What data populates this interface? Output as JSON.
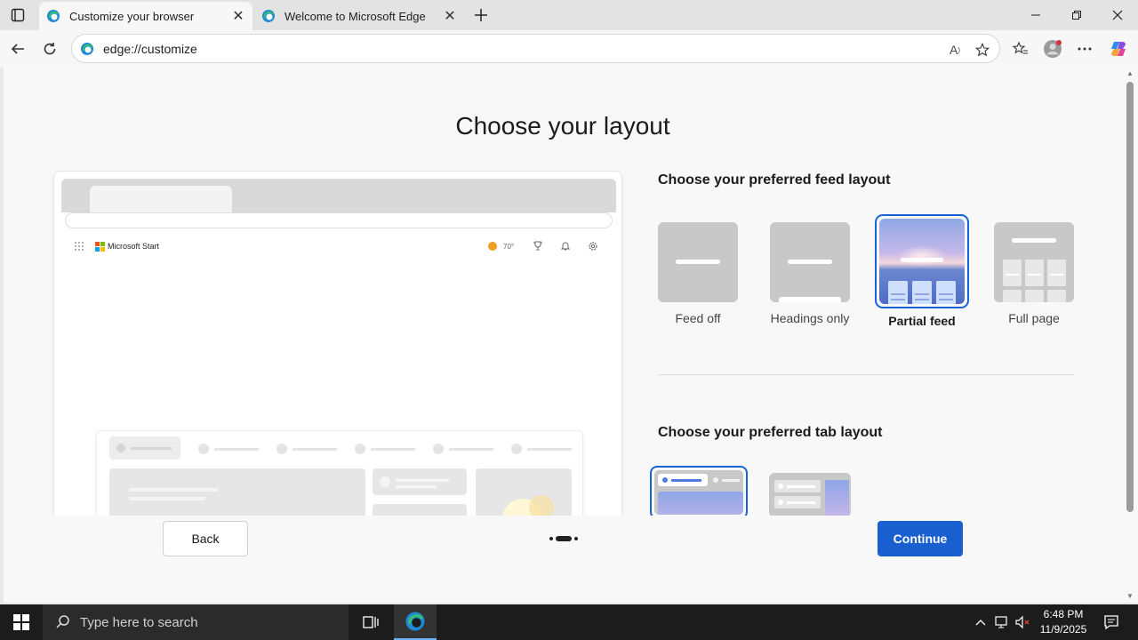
{
  "browser": {
    "tabs": [
      {
        "title": "Customize your browser",
        "active": true
      },
      {
        "title": "Welcome to Microsoft Edge",
        "active": false
      }
    ],
    "address": "edge://customize"
  },
  "page": {
    "heading": "Choose your layout",
    "preview": {
      "brand": "Microsoft Start",
      "temperature": "70°"
    },
    "feed_section": {
      "title": "Choose your preferred feed layout",
      "options": [
        {
          "label": "Feed off",
          "selected": false
        },
        {
          "label": "Headings only",
          "selected": false
        },
        {
          "label": "Partial feed",
          "selected": true
        },
        {
          "label": "Full page",
          "selected": false
        }
      ]
    },
    "tab_section": {
      "title": "Choose your preferred tab layout"
    },
    "footer": {
      "back_label": "Back",
      "continue_label": "Continue",
      "step_current": 2,
      "step_total": 3
    }
  },
  "taskbar": {
    "search_placeholder": "Type here to search",
    "time": "6:48 PM",
    "date": "11/9/2025"
  },
  "colors": {
    "accent": "#1a5fd0",
    "selected_border": "#1a63d6",
    "taskbar": "#1c1c1c"
  }
}
